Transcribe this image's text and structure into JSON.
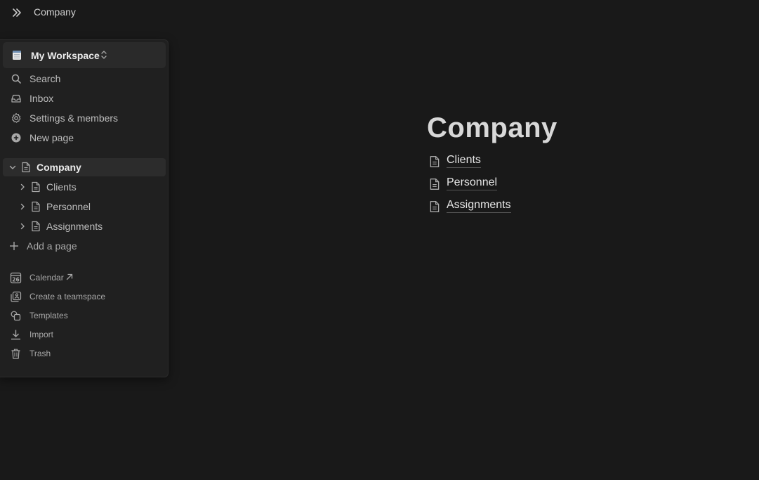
{
  "topbar": {
    "breadcrumb": "Company"
  },
  "workspace": {
    "name": "My Workspace"
  },
  "menu": [
    {
      "label": "Search",
      "icon": "search-icon"
    },
    {
      "label": "Inbox",
      "icon": "inbox-icon"
    },
    {
      "label": "Settings & members",
      "icon": "gear-icon"
    },
    {
      "label": "New page",
      "icon": "plus-circle-icon"
    }
  ],
  "tree": {
    "root": "Company",
    "children": [
      "Clients",
      "Personnel",
      "Assignments"
    ],
    "add_page": "Add a page"
  },
  "footer": [
    {
      "label": "Calendar",
      "icon": "calendar-icon"
    },
    {
      "label": "Create a teamspace",
      "icon": "teamspace-icon"
    },
    {
      "label": "Templates",
      "icon": "templates-icon"
    },
    {
      "label": "Import",
      "icon": "import-icon"
    },
    {
      "label": "Trash",
      "icon": "trash-icon"
    }
  ],
  "calendar_day": "26",
  "page": {
    "title": "Company",
    "links": [
      "Clients",
      "Personnel",
      "Assignments"
    ]
  }
}
